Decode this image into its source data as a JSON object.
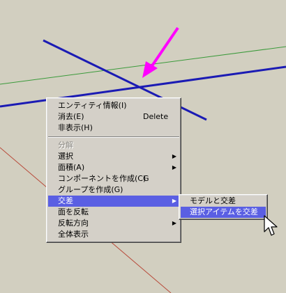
{
  "context_menu": {
    "items": [
      {
        "label": "エンティティ情報(I)"
      },
      {
        "label": "消去(E)",
        "shortcut": "Delete"
      },
      {
        "label": "非表示(H)"
      },
      {
        "label": "分解"
      },
      {
        "label": "選択"
      },
      {
        "label": "面積(A)"
      },
      {
        "label": "コンポーネントを作成(C)",
        "shortcut": "G"
      },
      {
        "label": "グループを作成(G)"
      },
      {
        "label": "交差"
      },
      {
        "label": "面を反転"
      },
      {
        "label": "反転方向"
      },
      {
        "label": "全体表示"
      }
    ]
  },
  "submenu": {
    "items": [
      {
        "label": "モデルと交差"
      },
      {
        "label": "選択アイテムを交差"
      }
    ]
  },
  "colors": {
    "background": "#d2cfc0",
    "menu_bg": "#d4d0c8",
    "highlight": "#5a5fe3",
    "magenta_arrow": "#ff00ff",
    "blue_edge": "#1b1bb4",
    "green_axis": "#3a9a3a",
    "red_axis": "#b84a3a"
  },
  "icons": {
    "submenu_arrow": "triangle-right-icon",
    "annotation": "magenta-arrow-icon",
    "cursor": "mouse-pointer-icon"
  }
}
